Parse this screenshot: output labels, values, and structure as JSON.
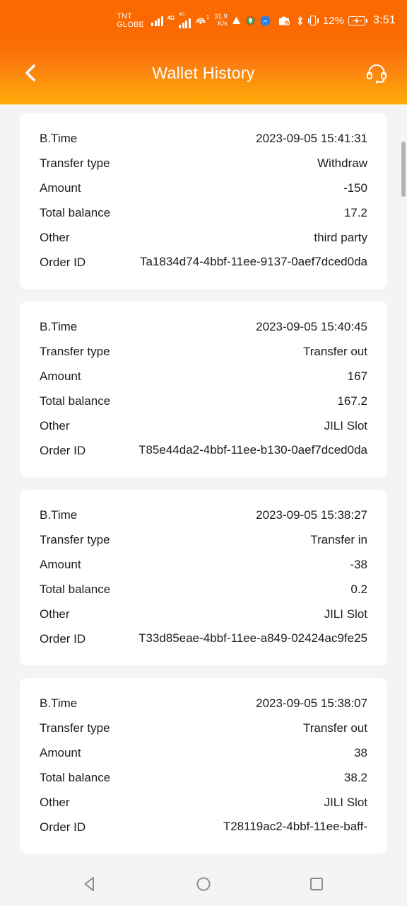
{
  "status_bar": {
    "carrier": "TNT\nGLOBE",
    "network_label": "4G",
    "network_sup": "+",
    "network_sub": "4G",
    "hotspot_badge": "1",
    "data_speed_value": "31.9",
    "data_speed_unit": "K/s",
    "battery_percent": "12%",
    "clock": "3:51",
    "icons": [
      "signal-bars-icon",
      "4g-plus-icon",
      "signal-bars-2-icon",
      "hotspot-icon",
      "data-speed-icon",
      "alarm-icon",
      "location-icon",
      "messenger-icon",
      "no-photo-icon",
      "bluetooth-icon",
      "vibrate-icon",
      "battery-charging-icon"
    ]
  },
  "header": {
    "title": "Wallet History",
    "back_icon": "chevron-left-icon",
    "support_icon": "headset-icon"
  },
  "labels": {
    "b_time": "B.Time",
    "transfer_type": "Transfer type",
    "amount": "Amount",
    "total_balance": "Total balance",
    "other": "Other",
    "order_id": "Order ID"
  },
  "transactions": [
    {
      "b_time": "2023-09-05 15:41:31",
      "transfer_type": "Withdraw",
      "amount": "-150",
      "total_balance": "17.2",
      "other": "third party",
      "order_id": "Ta1834d74-4bbf-11ee-9137-0aef7dced0da"
    },
    {
      "b_time": "2023-09-05 15:40:45",
      "transfer_type": "Transfer out",
      "amount": "167",
      "total_balance": "167.2",
      "other": "JILI Slot",
      "order_id": "T85e44da2-4bbf-11ee-b130-0aef7dced0da"
    },
    {
      "b_time": "2023-09-05 15:38:27",
      "transfer_type": "Transfer in",
      "amount": "-38",
      "total_balance": "0.2",
      "other": "JILI Slot",
      "order_id": "T33d85eae-4bbf-11ee-a849-02424ac9fe25"
    },
    {
      "b_time": "2023-09-05 15:38:07",
      "transfer_type": "Transfer out",
      "amount": "38",
      "total_balance": "38.2",
      "other": "JILI Slot",
      "order_id": "T28119ac2-4bbf-11ee-baff-"
    }
  ],
  "bottom_nav": {
    "back": "back-triangle-icon",
    "home": "home-circle-icon",
    "recents": "recents-square-icon"
  },
  "colors": {
    "header_top": "#fb6a00",
    "header_bottom": "#ffaa09",
    "page_bg": "#f4f4f6",
    "card_bg": "#ffffff",
    "text": "#1c1c1c",
    "scrollbar": "#b3b3b3"
  }
}
